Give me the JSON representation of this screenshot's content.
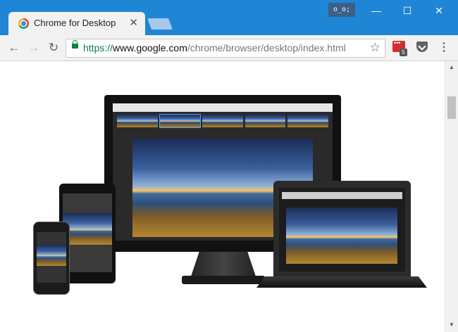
{
  "window": {
    "profile_label": "o_o;",
    "controls": {
      "minimize": "—",
      "maximize": "☐",
      "close": "✕"
    }
  },
  "tabs": [
    {
      "title": "Chrome for Desktop",
      "favicon": "chrome-logo-icon",
      "close": "✕",
      "active": true
    }
  ],
  "toolbar": {
    "back": "←",
    "forward": "→",
    "reload": "↻",
    "url": {
      "scheme": "https://",
      "host": "www.google.com",
      "path": "/chrome/browser/desktop/index.html"
    },
    "bookmark_star": "☆",
    "extensions": [
      {
        "name": "lastpass-icon",
        "badge": "5"
      },
      {
        "name": "pocket-icon"
      }
    ],
    "menu": "⋮"
  },
  "scrollbar": {
    "up": "▲",
    "down": "▼"
  },
  "colors": {
    "titlebar": "#1f86d6",
    "toolbar": "#f2f2f2",
    "secure_green": "#0b8043"
  }
}
